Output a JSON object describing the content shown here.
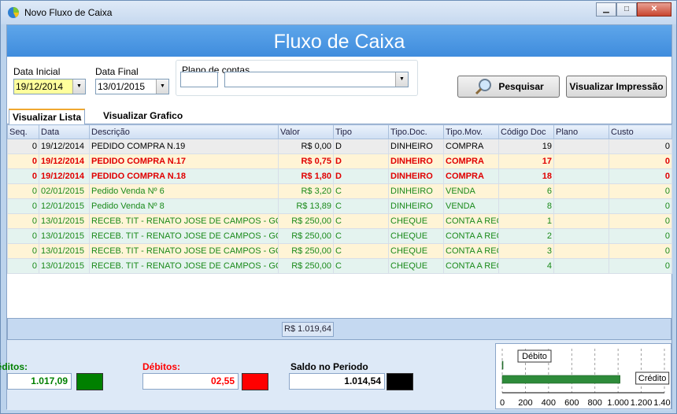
{
  "window": {
    "title": "Novo Fluxo de Caixa",
    "icon": "app-pie-icon"
  },
  "banner": {
    "title": "Fluxo de Caixa"
  },
  "filters": {
    "data_inicial_label": "Data Inicial",
    "data_inicial_value": "19/12/2014",
    "data_final_label": "Data Final",
    "data_final_value": "13/01/2015",
    "plano_label": "Plano de contas",
    "plano_code": "",
    "plano_value": ""
  },
  "buttons": {
    "pesquisar": "Pesquisar",
    "visualizar_impressao": "Visualizar Impressão"
  },
  "tabs": [
    {
      "label": "Visualizar Lista"
    },
    {
      "label": "Visualizar Grafico"
    }
  ],
  "grid": {
    "columns": [
      "Seq.",
      "Data",
      "Descrição",
      "Valor",
      "Tipo",
      "Tipo.Doc.",
      "Tipo.Mov.",
      "Código Doc",
      "Plano",
      "Custo"
    ],
    "rows": [
      {
        "seq": "0",
        "data": "19/12/2014",
        "descricao": "PEDIDO COMPRA N.19",
        "valor": "R$ 0,00",
        "tipo": "D",
        "tipo_doc": "DINHEIRO",
        "tipo_mov": "COMPRA",
        "codigo": "19",
        "plano": "",
        "custo": "0",
        "color": "#000000",
        "bg": "#ececec",
        "bold": false
      },
      {
        "seq": "0",
        "data": "19/12/2014",
        "descricao": "PEDIDO COMPRA N.17",
        "valor": "R$ 0,75",
        "tipo": "D",
        "tipo_doc": "DINHEIRO",
        "tipo_mov": "COMPRA",
        "codigo": "17",
        "plano": "",
        "custo": "0",
        "color": "#e00000",
        "bg": "#fff4d6",
        "bold": true
      },
      {
        "seq": "0",
        "data": "19/12/2014",
        "descricao": "PEDIDO COMPRA N.18",
        "valor": "R$ 1,80",
        "tipo": "D",
        "tipo_doc": "DINHEIRO",
        "tipo_mov": "COMPRA",
        "codigo": "18",
        "plano": "",
        "custo": "0",
        "color": "#e00000",
        "bg": "#e4f3ef",
        "bold": true
      },
      {
        "seq": "0",
        "data": "02/01/2015",
        "descricao": "Pedido Venda Nº 6",
        "valor": "R$ 3,20",
        "tipo": "C",
        "tipo_doc": "DINHEIRO",
        "tipo_mov": "VENDA",
        "codigo": "6",
        "plano": "",
        "custo": "0",
        "color": "#1a8a1a",
        "bg": "#fff4d6",
        "bold": false
      },
      {
        "seq": "0",
        "data": "12/01/2015",
        "descricao": "Pedido Venda Nº 8",
        "valor": "R$ 13,89",
        "tipo": "C",
        "tipo_doc": "DINHEIRO",
        "tipo_mov": "VENDA",
        "codigo": "8",
        "plano": "",
        "custo": "0",
        "color": "#1a8a1a",
        "bg": "#e4f3ef",
        "bold": false
      },
      {
        "seq": "0",
        "data": "13/01/2015",
        "descricao": "RECEB. TIT - RENATO JOSE DE CAMPOS - GOIANIA",
        "valor": "R$ 250,00",
        "tipo": "C",
        "tipo_doc": "CHEQUE",
        "tipo_mov": "CONTA A RECEBER",
        "codigo": "1",
        "plano": "",
        "custo": "0",
        "color": "#1a8a1a",
        "bg": "#fff4d6",
        "bold": false
      },
      {
        "seq": "0",
        "data": "13/01/2015",
        "descricao": "RECEB. TIT - RENATO JOSE DE CAMPOS - GOIANIA",
        "valor": "R$ 250,00",
        "tipo": "C",
        "tipo_doc": "CHEQUE",
        "tipo_mov": "CONTA A RECEBER",
        "codigo": "2",
        "plano": "",
        "custo": "0",
        "color": "#1a8a1a",
        "bg": "#e4f3ef",
        "bold": false
      },
      {
        "seq": "0",
        "data": "13/01/2015",
        "descricao": "RECEB. TIT - RENATO JOSE DE CAMPOS - GOIANIA",
        "valor": "R$ 250,00",
        "tipo": "C",
        "tipo_doc": "CHEQUE",
        "tipo_mov": "CONTA A RECEBER",
        "codigo": "3",
        "plano": "",
        "custo": "0",
        "color": "#1a8a1a",
        "bg": "#fff4d6",
        "bold": false
      },
      {
        "seq": "0",
        "data": "13/01/2015",
        "descricao": "RECEB. TIT - RENATO JOSE DE CAMPOS - GOIANIA",
        "valor": "R$ 250,00",
        "tipo": "C",
        "tipo_doc": "CHEQUE",
        "tipo_mov": "CONTA A RECEBER",
        "codigo": "4",
        "plano": "",
        "custo": "0",
        "color": "#1a8a1a",
        "bg": "#e4f3ef",
        "bold": false
      }
    ]
  },
  "summary": {
    "valor_total": "R$ 1.019,64"
  },
  "totals": {
    "creditos_label": "Créditos:",
    "creditos_value": "1.017,09",
    "creditos_color": "#008000",
    "debitos_label": "Débitos:",
    "debitos_value": "02,55",
    "debitos_color": "#ff0000",
    "saldo_label": "Saldo no Periodo",
    "saldo_value": "1.014,54",
    "saldo_color": "#000000"
  },
  "chart_data": {
    "type": "bar",
    "orientation": "horizontal",
    "categories": [
      "Crédito",
      "Débito"
    ],
    "values": [
      1017.09,
      2.55
    ],
    "colors": [
      "#2e8b3a",
      "#2e8b3a"
    ],
    "xlim": [
      0,
      1400
    ],
    "xticks": [
      "0",
      "200",
      "400",
      "600",
      "800",
      "1.000",
      "1.200",
      "1.400"
    ],
    "grid": true
  }
}
